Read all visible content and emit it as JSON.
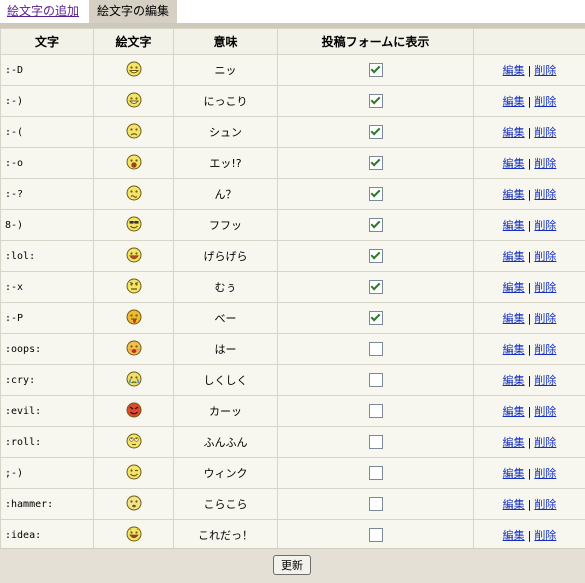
{
  "tabs": [
    {
      "label": "絵文字の追加",
      "active": false
    },
    {
      "label": "絵文字の編集",
      "active": true
    }
  ],
  "table": {
    "headers": [
      "文字",
      "絵文字",
      "意味",
      "投稿フォームに表示",
      ""
    ],
    "rows": [
      {
        "code": ":-D",
        "meaning": "ニッ",
        "show": true,
        "icon": "grin-icon"
      },
      {
        "code": ":-)",
        "meaning": "にっこり",
        "show": true,
        "icon": "smile-icon"
      },
      {
        "code": ":-(",
        "meaning": "シュン",
        "show": true,
        "icon": "sad-icon"
      },
      {
        "code": ":-o",
        "meaning": "エッ!?",
        "show": true,
        "icon": "surprised-icon"
      },
      {
        "code": ":-?",
        "meaning": "ん？",
        "show": true,
        "icon": "confused-icon"
      },
      {
        "code": "8-)",
        "meaning": "フフッ",
        "show": true,
        "icon": "cool-icon"
      },
      {
        "code": ":lol:",
        "meaning": "げらげら",
        "show": true,
        "icon": "lol-icon"
      },
      {
        "code": ":-x",
        "meaning": "むぅ",
        "show": true,
        "icon": "mad-icon"
      },
      {
        "code": ":-P",
        "meaning": "べー",
        "show": true,
        "icon": "tongue-icon"
      },
      {
        "code": ":oops:",
        "meaning": "はー",
        "show": false,
        "icon": "oops-icon"
      },
      {
        "code": ":cry:",
        "meaning": "しくしく",
        "show": false,
        "icon": "cry-icon"
      },
      {
        "code": ":evil:",
        "meaning": "カーッ",
        "show": false,
        "icon": "evil-icon"
      },
      {
        "code": ":roll:",
        "meaning": "ふんふん",
        "show": false,
        "icon": "rolleyes-icon"
      },
      {
        "code": ";-)",
        "meaning": "ウィンク",
        "show": false,
        "icon": "wink-icon"
      },
      {
        "code": ":hammer:",
        "meaning": "こらこら",
        "show": false,
        "icon": "hammer-icon"
      },
      {
        "code": ":idea:",
        "meaning": "これだっ！",
        "show": false,
        "icon": "idea-icon"
      }
    ],
    "edit_label": "編集",
    "delete_label": "削除",
    "separator": "|"
  },
  "footer": {
    "update_label": "更新"
  },
  "colors": {
    "tab_active_bg": "#d5d0c3",
    "link": "#1530c0",
    "visited_link": "#5a1f8f",
    "row_bg": "#f7f7ef",
    "header_bg": "#f2f2e8",
    "footer_bg": "#e4e0d6"
  }
}
